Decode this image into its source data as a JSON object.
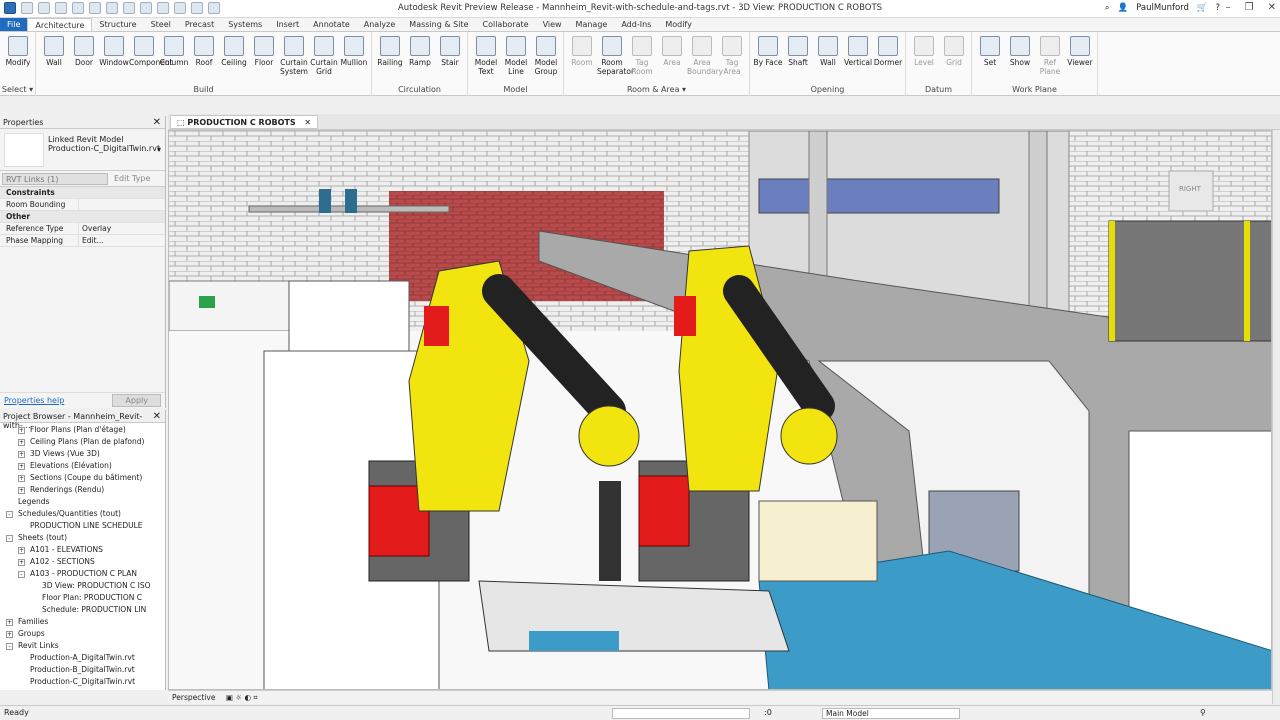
{
  "titlebar": {
    "title": "Autodesk Revit Preview Release - Mannheim_Revit-with-schedule-and-tags.rvt - 3D View: PRODUCTION C ROBOTS",
    "user": "PaulMunford"
  },
  "tabs": [
    "File",
    "Architecture",
    "Structure",
    "Steel",
    "Precast",
    "Systems",
    "Insert",
    "Annotate",
    "Analyze",
    "Massing & Site",
    "Collaborate",
    "View",
    "Manage",
    "Add-Ins",
    "Modify"
  ],
  "active_tab": "Architecture",
  "ribbon": {
    "groups": [
      {
        "label": "Select ▾",
        "buttons": [
          "Modify"
        ]
      },
      {
        "label": "Build",
        "buttons": [
          "Wall",
          "Door",
          "Window",
          "Component",
          "Column",
          "Roof",
          "Ceiling",
          "Floor",
          "Curtain System",
          "Curtain Grid",
          "Mullion"
        ]
      },
      {
        "label": "Circulation",
        "buttons": [
          "Railing",
          "Ramp",
          "Stair"
        ]
      },
      {
        "label": "Model",
        "buttons": [
          "Model Text",
          "Model Line",
          "Model Group"
        ]
      },
      {
        "label": "Room & Area ▾",
        "buttons": [
          "Room",
          "Room Separator",
          "Tag Room",
          "Area",
          "Area Boundary",
          "Tag Area"
        ]
      },
      {
        "label": "Opening",
        "buttons": [
          "By Face",
          "Shaft",
          "Wall",
          "Vertical",
          "Dormer"
        ]
      },
      {
        "label": "Datum",
        "buttons": [
          "Level",
          "Grid"
        ]
      },
      {
        "label": "Work Plane",
        "buttons": [
          "Set",
          "Show",
          "Ref Plane",
          "Viewer"
        ]
      }
    ]
  },
  "properties": {
    "header": "Properties",
    "type_name_1": "Linked Revit Model",
    "type_name_2": "Production-C_DigitalTwin.rvt",
    "selector": "RVT Links (1)",
    "edit_type": "Edit Type",
    "sections": [
      {
        "name": "Constraints",
        "rows": [
          {
            "k": "Room Bounding",
            "v": ""
          }
        ]
      },
      {
        "name": "Other",
        "rows": [
          {
            "k": "Reference Type",
            "v": "Overlay"
          },
          {
            "k": "Phase Mapping",
            "v": "Edit..."
          }
        ]
      }
    ],
    "help": "Properties help",
    "apply": "Apply"
  },
  "browser": {
    "header": "Project Browser - Mannheim_Revit-with-...",
    "items": [
      {
        "label": "Floor Plans (Plan d'étage)",
        "indent": 1,
        "exp": "+"
      },
      {
        "label": "Ceiling Plans (Plan de plafond)",
        "indent": 1,
        "exp": "+"
      },
      {
        "label": "3D Views (Vue 3D)",
        "indent": 1,
        "exp": "+"
      },
      {
        "label": "Elevations (Élévation)",
        "indent": 1,
        "exp": "+"
      },
      {
        "label": "Sections (Coupe du bâtiment)",
        "indent": 1,
        "exp": "+"
      },
      {
        "label": "Renderings (Rendu)",
        "indent": 1,
        "exp": "+"
      },
      {
        "label": "Legends",
        "indent": 0,
        "exp": ""
      },
      {
        "label": "Schedules/Quantities (tout)",
        "indent": 0,
        "exp": "-"
      },
      {
        "label": "PRODUCTION LINE SCHEDULE",
        "indent": 1,
        "exp": ""
      },
      {
        "label": "Sheets (tout)",
        "indent": 0,
        "exp": "-"
      },
      {
        "label": "A101 - ELEVATIONS",
        "indent": 1,
        "exp": "+"
      },
      {
        "label": "A102 - SECTIONS",
        "indent": 1,
        "exp": "+"
      },
      {
        "label": "A103 - PRODUCTION C PLAN",
        "indent": 1,
        "exp": "-"
      },
      {
        "label": "3D View: PRODUCTION C ISO",
        "indent": 2,
        "exp": ""
      },
      {
        "label": "Floor Plan: PRODUCTION C",
        "indent": 2,
        "exp": ""
      },
      {
        "label": "Schedule: PRODUCTION LIN",
        "indent": 2,
        "exp": ""
      },
      {
        "label": "Families",
        "indent": 0,
        "exp": "+"
      },
      {
        "label": "Groups",
        "indent": 0,
        "exp": "+"
      },
      {
        "label": "Revit Links",
        "indent": 0,
        "exp": "-"
      },
      {
        "label": "Production-A_DigitalTwin.rvt",
        "indent": 1,
        "exp": ""
      },
      {
        "label": "Production-B_DigitalTwin.rvt",
        "indent": 1,
        "exp": ""
      },
      {
        "label": "Production-C_DigitalTwin.rvt",
        "indent": 1,
        "exp": ""
      }
    ]
  },
  "view": {
    "tab": "PRODUCTION C ROBOTS",
    "viewcube_label": "RIGHT",
    "projection": "Perspective"
  },
  "status": {
    "text": "Ready",
    "zero": ":0",
    "model": "Main Model"
  }
}
